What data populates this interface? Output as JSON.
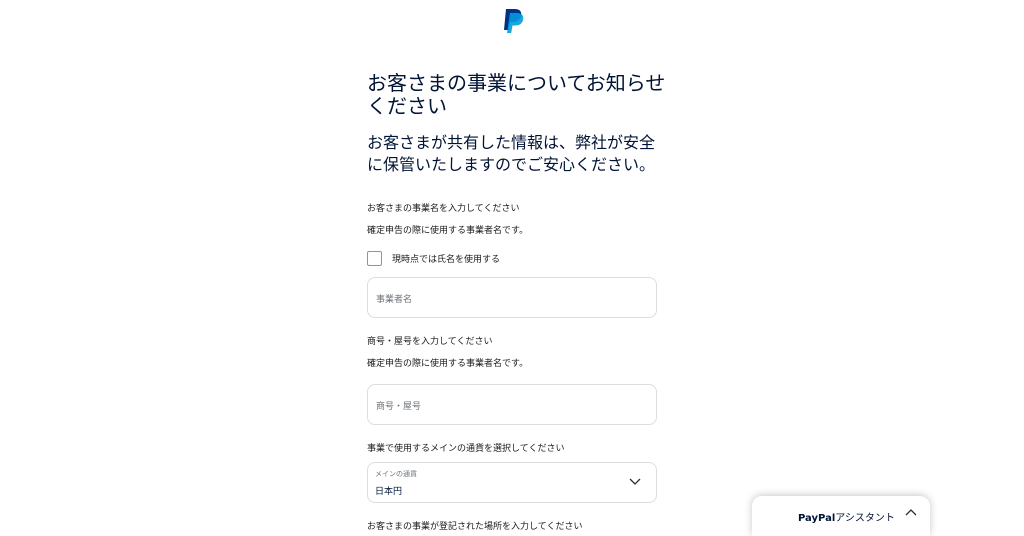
{
  "header": {
    "logo_icon": "paypal-logo"
  },
  "form": {
    "title": "お客さまの事業についてお知らせください",
    "subtitle": "お客さまが共有した情報は、弊社が安全に保管いたしますのでご安心ください。",
    "business_name": {
      "label": "お客さまの事業名を入力してください",
      "help": "確定申告の際に使用する事業者名です。",
      "checkbox_label": "現時点では氏名を使用する",
      "checkbox_checked": false,
      "placeholder": "事業者名"
    },
    "trade_name": {
      "label": "商号・屋号を入力してください",
      "help": "確定申告の際に使用する事業者名です。",
      "placeholder": "商号・屋号"
    },
    "currency": {
      "label": "事業で使用するメインの通貨を選択してください",
      "field_label": "メインの通貨",
      "value": "日本円",
      "icon": "chevron-down-icon"
    },
    "address": {
      "label": "お客さまの事業が登記された場所を入力してください"
    }
  },
  "assistant": {
    "brand": "PayPal",
    "suffix": "アシスタント",
    "icon": "chevron-up-icon"
  },
  "colors": {
    "logo_dark": "#003087",
    "logo_light": "#009cde",
    "text": "#001435",
    "border": "#dbdde3"
  }
}
